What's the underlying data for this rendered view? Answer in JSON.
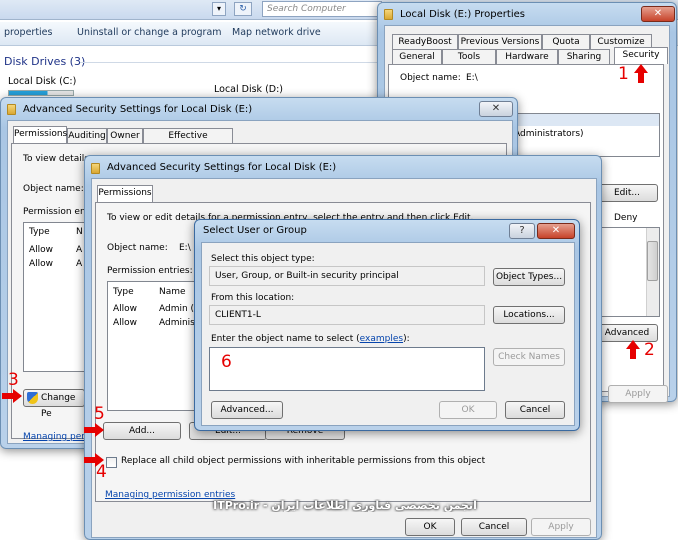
{
  "explorer": {
    "search_placeholder": "Search Computer",
    "toolbar": [
      "properties",
      "Uninstall or change a program",
      "Map network drive"
    ],
    "section_title": "Disk Drives (3)",
    "drives": [
      "Local Disk (C:)",
      "Local Disk (D:)"
    ]
  },
  "properties": {
    "title": "Local Disk (E:) Properties",
    "tabs_row1": [
      "ReadyBoost",
      "Previous Versions",
      "Quota",
      "Customize"
    ],
    "tabs_row2": [
      "General",
      "Tools",
      "Hardware",
      "Sharing",
      "Security"
    ],
    "object_name_label": "Object name:",
    "object_name_value": "E:\\",
    "list_item": "Administrators)",
    "edit_button": "Edit...",
    "deny_label": "Deny",
    "advanced_button": "Advanced",
    "apply_button": "Apply"
  },
  "adv1": {
    "title": "Advanced Security Settings for Local Disk (E:)",
    "tabs": [
      "Permissions",
      "Auditing",
      "Owner",
      "Effective Permissions"
    ],
    "to_view": "To view details",
    "object_name_label": "Object name:",
    "entries_label": "Permission entries:",
    "col_type": "Type",
    "col_name": "N",
    "rows": [
      [
        "Allow",
        "A"
      ],
      [
        "Allow",
        "A"
      ]
    ],
    "change_button": "Change Pe",
    "manage_link": "Managing perm"
  },
  "adv2": {
    "title": "Advanced Security Settings for Local Disk (E:)",
    "tab": "Permissions",
    "description": "To view or edit details for a permission entry, select the entry and then click Edit.",
    "object_name_label": "Object name:",
    "object_name_value": "E:\\",
    "entries_label": "Permission entries:",
    "col_type": "Type",
    "col_name": "Name",
    "rows": [
      [
        "Allow",
        "Admin (C"
      ],
      [
        "Allow",
        "Administ"
      ]
    ],
    "add_button": "Add...",
    "edit_button": "Edit...",
    "remove_button": "Remove",
    "replace_checkbox": "Replace all child object permissions with inheritable permissions from this object",
    "manage_link": "Managing permission entries",
    "ok_button": "OK",
    "cancel_button": "Cancel",
    "apply_button": "Apply"
  },
  "select_dialog": {
    "title": "Select User or Group",
    "help_button": "?",
    "object_type_label": "Select this object type:",
    "object_type_value": "User, Group, or Built-in security principal",
    "object_types_button": "Object Types...",
    "location_label": "From this location:",
    "location_value": "CLIENT1-L",
    "locations_button": "Locations...",
    "enter_label": "Enter the object name to select (",
    "examples_link": "examples",
    "enter_label_end": "):",
    "check_names_button": "Check Names",
    "advanced_button": "Advanced...",
    "ok_button": "OK",
    "cancel_button": "Cancel"
  },
  "annotations": [
    "1",
    "2",
    "3",
    "4",
    "5",
    "6"
  ],
  "watermark": "ITPro.ir - انجمن تخصصی فناوری اطلاعات ایران",
  "colors": {
    "annotation_red": "#e60000",
    "link_blue": "#0645ad"
  }
}
